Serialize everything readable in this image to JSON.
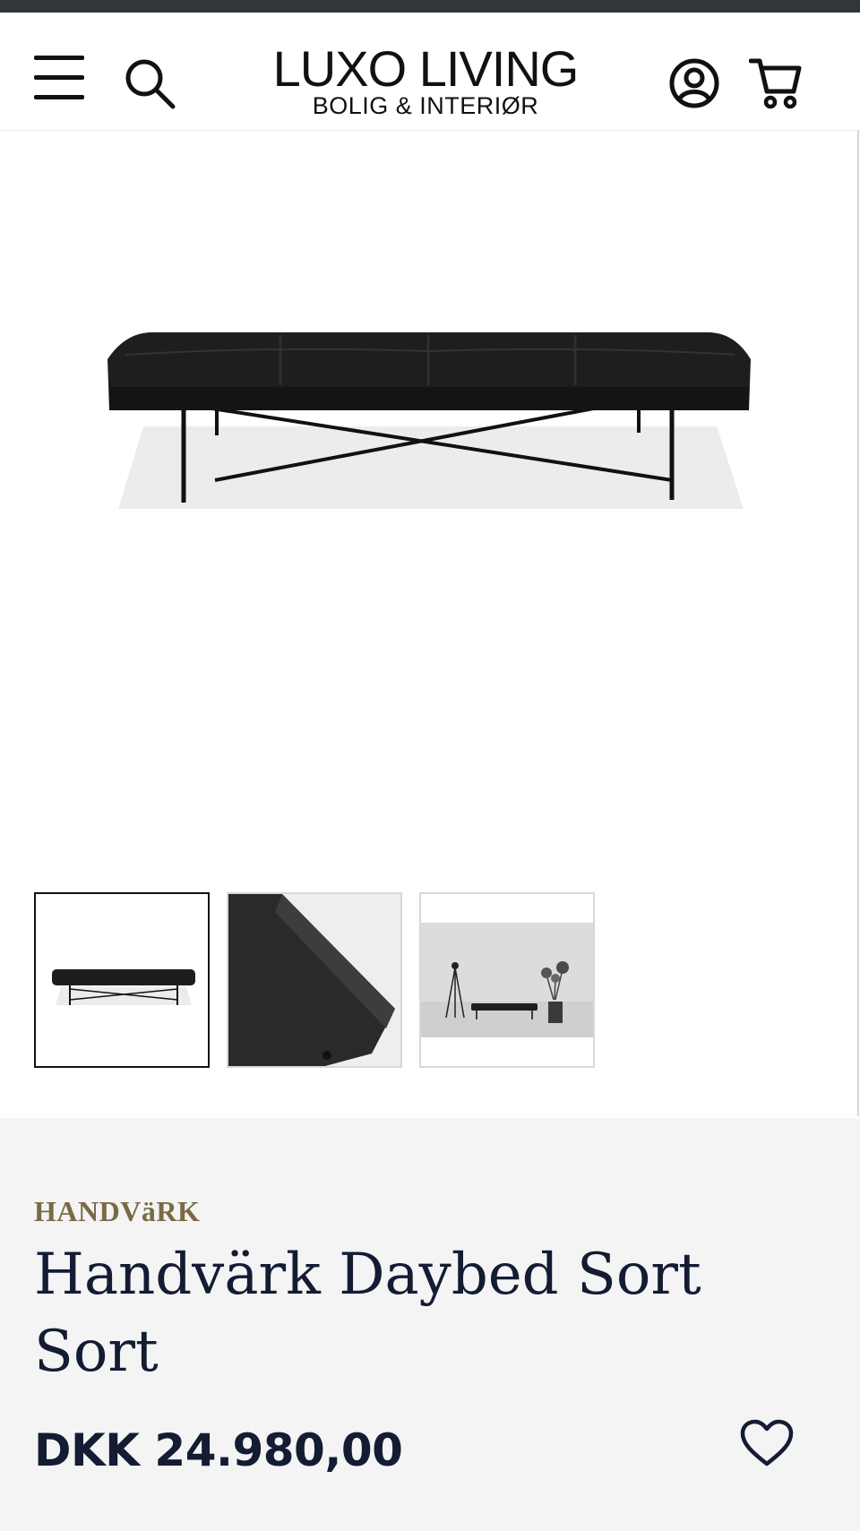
{
  "header": {
    "logo_title": "LUXO LIVING",
    "logo_subtitle": "BOLIG & INTERIØR",
    "icons": [
      "menu-icon",
      "search-icon",
      "account-icon",
      "cart-icon"
    ]
  },
  "gallery": {
    "main_image": "daybed-product-image",
    "thumbnails": [
      {
        "name": "daybed-front-view",
        "active": true
      },
      {
        "name": "leather-detail-view",
        "active": false
      },
      {
        "name": "room-scene-view",
        "active": false
      }
    ]
  },
  "product": {
    "brand": "HANDVäRK",
    "title": "Handvärk Daybed Sort Sort",
    "price": "DKK 24.980,00",
    "wishlist_icon": "heart-icon"
  },
  "colors": {
    "brand_text": "#7a6a45",
    "title_text": "#141c34",
    "info_background": "#f4f4f5"
  }
}
